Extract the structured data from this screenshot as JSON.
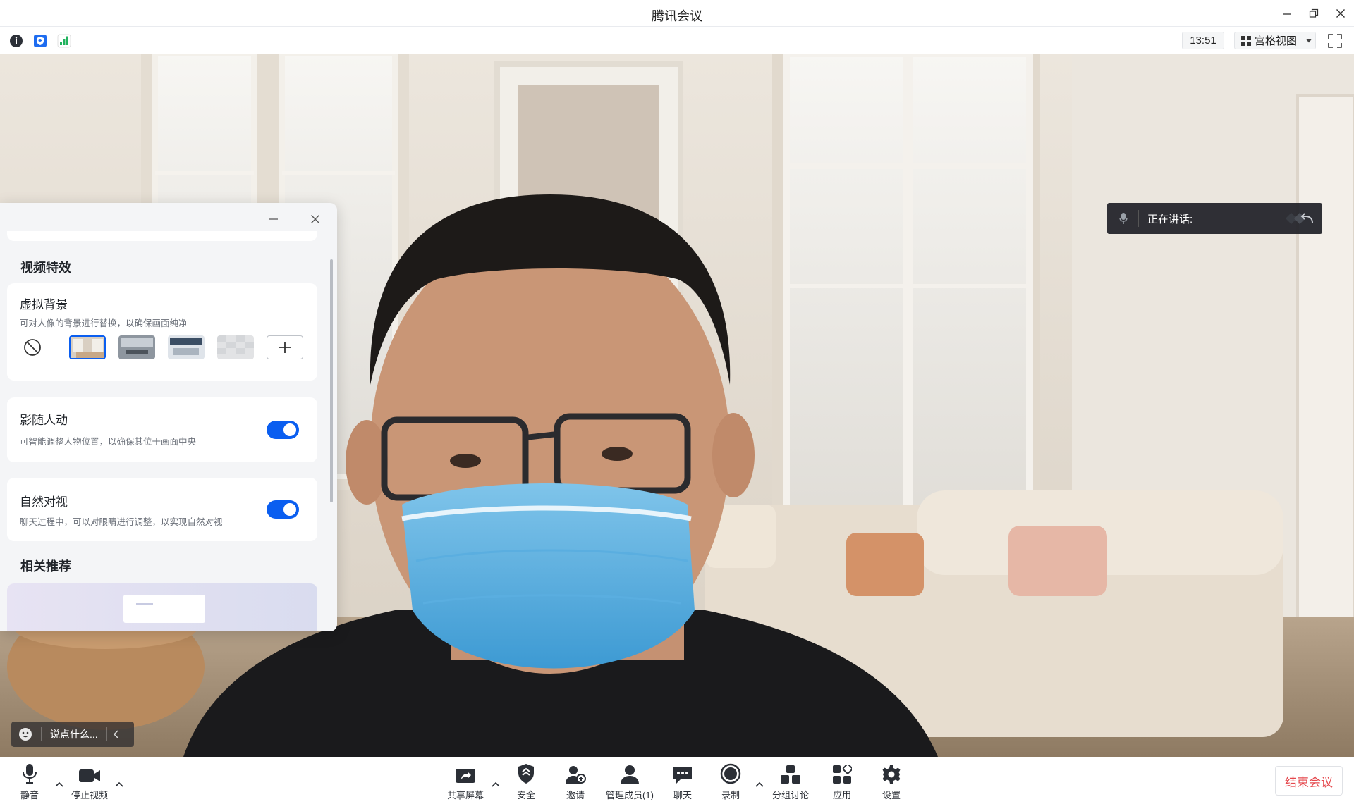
{
  "app": {
    "title": "腾讯会议"
  },
  "infobar": {
    "clock": "13:51",
    "view_label": "宫格视图"
  },
  "speaking": {
    "label": "正在讲话:"
  },
  "comment": {
    "placeholder": "说点什么..."
  },
  "panel": {
    "section_title": "视频特效",
    "virtual_bg": {
      "title": "虚拟背景",
      "desc": "可对人像的背景进行替换，以确保画面纯净"
    },
    "follow": {
      "title": "影随人动",
      "desc": "可智能调整人物位置，以确保其位于画面中央",
      "enabled": true
    },
    "gaze": {
      "title": "自然对视",
      "desc": "聊天过程中，可以对眼睛进行调整，以实现自然对视",
      "enabled": true
    },
    "related_title": "相关推荐"
  },
  "toolbar": {
    "mute": "静音",
    "stop_video": "停止视频",
    "share": "共享屏幕",
    "security": "安全",
    "invite": "邀请",
    "members": "管理成员(1)",
    "chat": "聊天",
    "record": "录制",
    "breakout": "分组讨论",
    "apps": "应用",
    "settings": "设置",
    "end": "结束会议"
  },
  "colors": {
    "accent": "#0a5ef0",
    "end_red": "#e5484d"
  }
}
